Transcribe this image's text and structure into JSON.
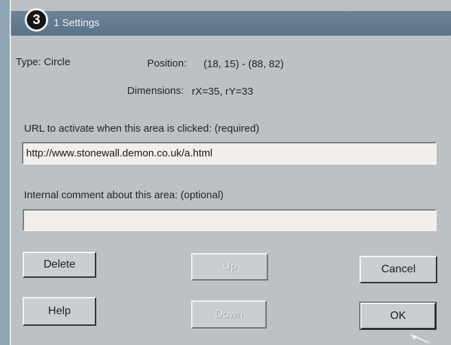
{
  "dialog": {
    "title": "1 Settings",
    "badge": "3"
  },
  "info": {
    "type_label": "Type: Circle",
    "position_label": "Position:",
    "position_value": "(18, 15) - (88, 82)",
    "dimensions_label": "Dimensions:",
    "dimensions_value": "rX=35, rY=33"
  },
  "url_section": {
    "label": "URL to activate when this area is clicked: (required)",
    "value": "http://www.stonewall.demon.co.uk/a.html"
  },
  "comment_section": {
    "label": "Internal comment about this area: (optional)",
    "value": ""
  },
  "buttons": {
    "delete": "Delete",
    "up": "Up",
    "cancel": "Cancel",
    "help": "Help",
    "down": "Down",
    "ok": "OK"
  }
}
